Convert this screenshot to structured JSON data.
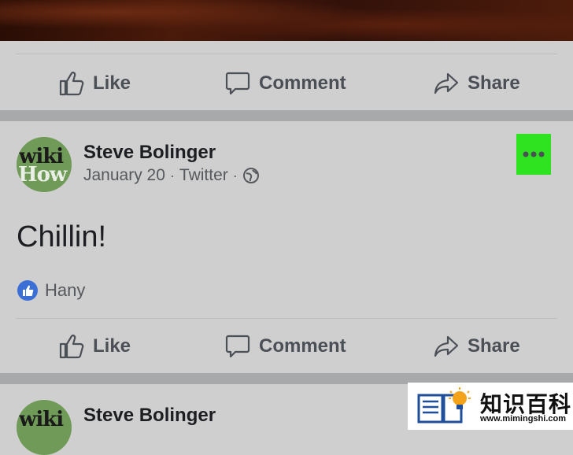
{
  "actions": {
    "like": "Like",
    "comment": "Comment",
    "share": "Share"
  },
  "post": {
    "author": "Steve Bolinger",
    "date": "January 20",
    "source": "Twitter",
    "text": "Chillin!",
    "reactor": "Hany",
    "avatar_line1": "wiki",
    "avatar_line2": "How"
  },
  "next_post": {
    "author": "Steve Bolinger",
    "avatar_line1": "wiki"
  },
  "more_button": {
    "icon": "ellipsis-icon",
    "highlight_color": "#2fe321"
  },
  "watermark": {
    "title": "知识百科",
    "url": "www.mimingshi.com"
  },
  "colors": {
    "background": "#cfcfcf",
    "separator": "#a8a9ab",
    "action_text": "#4b4f56",
    "like_blue": "#3b6fd6"
  }
}
